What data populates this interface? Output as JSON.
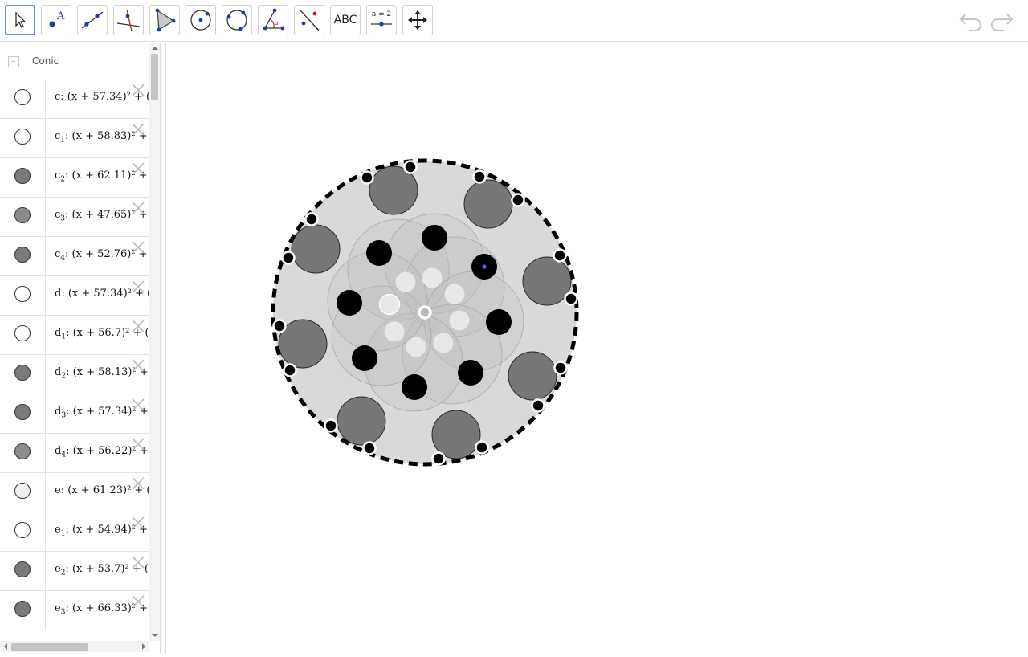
{
  "toolbar": {
    "tools": [
      {
        "name": "move-tool",
        "active": true
      },
      {
        "name": "point-tool"
      },
      {
        "name": "line-tool"
      },
      {
        "name": "perpendicular-line-tool"
      },
      {
        "name": "polygon-tool"
      },
      {
        "name": "circle-center-point-tool"
      },
      {
        "name": "circle-three-points-tool"
      },
      {
        "name": "angle-tool"
      },
      {
        "name": "reflect-tool"
      },
      {
        "name": "text-tool",
        "label": "ABC"
      },
      {
        "name": "slider-tool",
        "label": "a = 2"
      },
      {
        "name": "move-graphics-view-tool"
      }
    ],
    "undo_icon": "undo-icon",
    "redo_icon": "redo-icon"
  },
  "algebra": {
    "group_label": "Conic",
    "collapse_symbol": "–",
    "rows": [
      {
        "name": "c",
        "sub": "",
        "expr": "(x + 57.34)² + (y",
        "fill": "#ffffff"
      },
      {
        "name": "c",
        "sub": "1",
        "expr": "(x + 58.83)² + (",
        "fill": "#ffffff"
      },
      {
        "name": "c",
        "sub": "2",
        "expr": "(x + 62.11)² + (",
        "fill": "#7a7a7a"
      },
      {
        "name": "c",
        "sub": "3",
        "expr": "(x + 47.65)² + (",
        "fill": "#8c8c8c"
      },
      {
        "name": "c",
        "sub": "4",
        "expr": "(x + 52.76)² + (",
        "fill": "#7a7a7a"
      },
      {
        "name": "d",
        "sub": "",
        "expr": "(x + 57.34)² + (y",
        "fill": "#ffffff"
      },
      {
        "name": "d",
        "sub": "1",
        "expr": "(x + 56.7)² + (y",
        "fill": "#ffffff"
      },
      {
        "name": "d",
        "sub": "2",
        "expr": "(x + 58.13)² + (",
        "fill": "#7a7a7a"
      },
      {
        "name": "d",
        "sub": "3",
        "expr": "(x + 57.34)² + (",
        "fill": "#7a7a7a"
      },
      {
        "name": "d",
        "sub": "4",
        "expr": "(x + 56.22)² + (",
        "fill": "#8c8c8c"
      },
      {
        "name": "e",
        "sub": "",
        "expr": "(x + 61.23)² + (y",
        "fill": "#f0f0f0"
      },
      {
        "name": "e",
        "sub": "1",
        "expr": "(x + 54.94)² + (",
        "fill": "#ffffff"
      },
      {
        "name": "e",
        "sub": "2",
        "expr": "(x + 53.7)² + (y",
        "fill": "#7a7a7a"
      },
      {
        "name": "e",
        "sub": "3",
        "expr": "(x + 66.33)² + (",
        "fill": "#7a7a7a"
      }
    ]
  },
  "colors": {
    "accent": "#6a8fd8",
    "disk_fill": "#d9d9d9",
    "outer_circle_gray": "#777777",
    "inner_black": "#000000",
    "inner_light": "#e8e8e8",
    "blue_point": "#4466ff"
  }
}
